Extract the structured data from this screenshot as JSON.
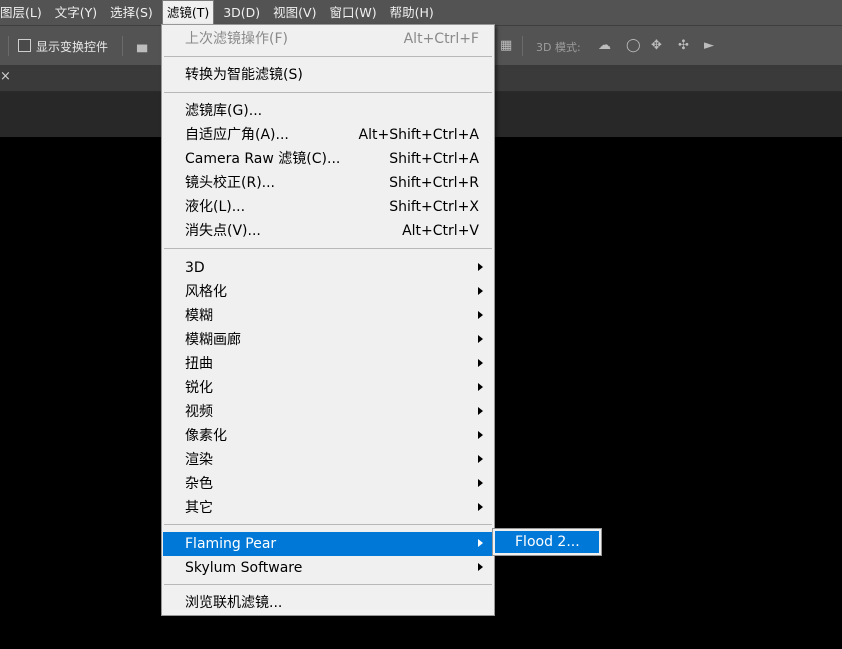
{
  "menubar": {
    "items": [
      {
        "label": "图层(L)"
      },
      {
        "label": "文字(Y)"
      },
      {
        "label": "选择(S)"
      },
      {
        "label": "滤镜(T)"
      },
      {
        "label": "3D(D)"
      },
      {
        "label": "视图(V)"
      },
      {
        "label": "窗口(W)"
      },
      {
        "label": "帮助(H)"
      }
    ]
  },
  "options": {
    "show_transform_label": "显示变换控件",
    "mode_label": "3D 模式:"
  },
  "filter_menu": {
    "last_filter": {
      "label": "上次滤镜操作(F)",
      "shortcut": "Alt+Ctrl+F"
    },
    "smart_filter": {
      "label": "转换为智能滤镜(S)"
    },
    "gallery": {
      "label": "滤镜库(G)..."
    },
    "adaptive_wide": {
      "label": "自适应广角(A)...",
      "shortcut": "Alt+Shift+Ctrl+A"
    },
    "camera_raw": {
      "label": "Camera Raw 滤镜(C)...",
      "shortcut": "Shift+Ctrl+A"
    },
    "lens_correction": {
      "label": "镜头校正(R)...",
      "shortcut": "Shift+Ctrl+R"
    },
    "liquify": {
      "label": "液化(L)...",
      "shortcut": "Shift+Ctrl+X"
    },
    "vanishing_point": {
      "label": "消失点(V)...",
      "shortcut": "Alt+Ctrl+V"
    },
    "submenus": [
      {
        "label": "3D"
      },
      {
        "label": "风格化"
      },
      {
        "label": "模糊"
      },
      {
        "label": "模糊画廊"
      },
      {
        "label": "扭曲"
      },
      {
        "label": "锐化"
      },
      {
        "label": "视频"
      },
      {
        "label": "像素化"
      },
      {
        "label": "渲染"
      },
      {
        "label": "杂色"
      },
      {
        "label": "其它"
      }
    ],
    "flaming_pear": {
      "label": "Flaming Pear"
    },
    "skylum": {
      "label": "Skylum Software"
    },
    "browse_online": {
      "label": "浏览联机滤镜..."
    }
  },
  "submenu": {
    "flood": {
      "label": "Flood 2..."
    }
  },
  "colors": {
    "highlight": "#0078d7",
    "menu_bg": "#f0f0f0",
    "chrome": "#535353"
  }
}
